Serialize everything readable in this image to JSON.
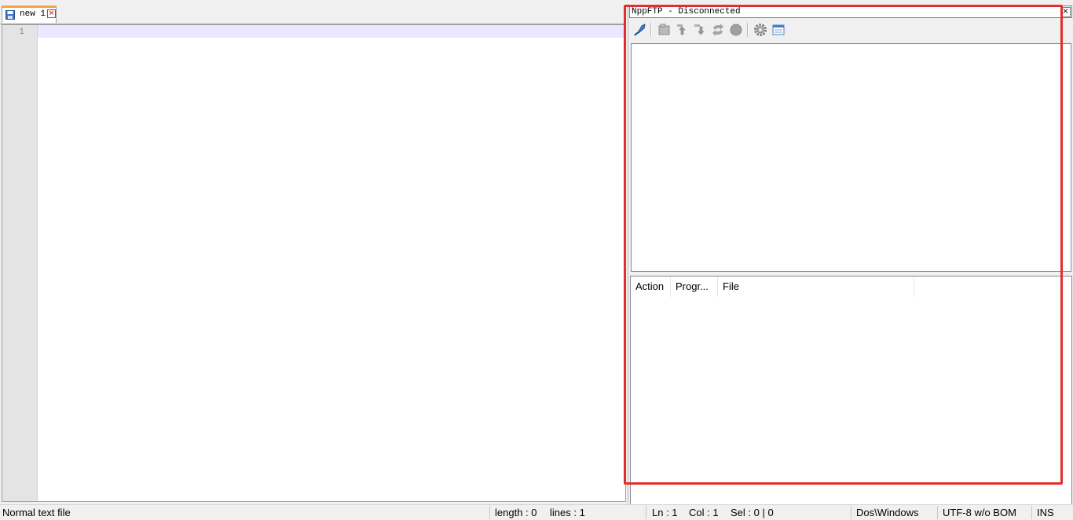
{
  "editor": {
    "tab": {
      "title": "new 1",
      "close_glyph": "×"
    },
    "line_numbers": [
      "1"
    ]
  },
  "ftp": {
    "title": "NppFTP - Disconnected",
    "close_glyph": "×",
    "toolbar": [
      {
        "icon": "connect-icon",
        "enabled": true
      },
      {
        "icon": "separator"
      },
      {
        "icon": "open-directory-icon",
        "enabled": false
      },
      {
        "icon": "download-icon",
        "enabled": false
      },
      {
        "icon": "upload-icon",
        "enabled": false
      },
      {
        "icon": "refresh-icon",
        "enabled": false
      },
      {
        "icon": "abort-icon",
        "enabled": false
      },
      {
        "icon": "separator"
      },
      {
        "icon": "settings-icon",
        "enabled": true
      },
      {
        "icon": "message-window-icon",
        "enabled": true
      }
    ],
    "queue_columns": [
      "Action",
      "Progr...",
      "File"
    ]
  },
  "statusbar": {
    "file_type": "Normal text file",
    "length": "length : 0",
    "lines": "lines : 1",
    "ln": "Ln : 1",
    "col": "Col : 1",
    "sel": "Sel : 0 | 0",
    "eol": "Dos\\Windows",
    "encoding": "UTF-8 w/o BOM",
    "mode": "INS"
  },
  "colors": {
    "highlight": "#e0302b",
    "tab_accent": "#f7a440",
    "current_line": "#e8e8ff"
  }
}
